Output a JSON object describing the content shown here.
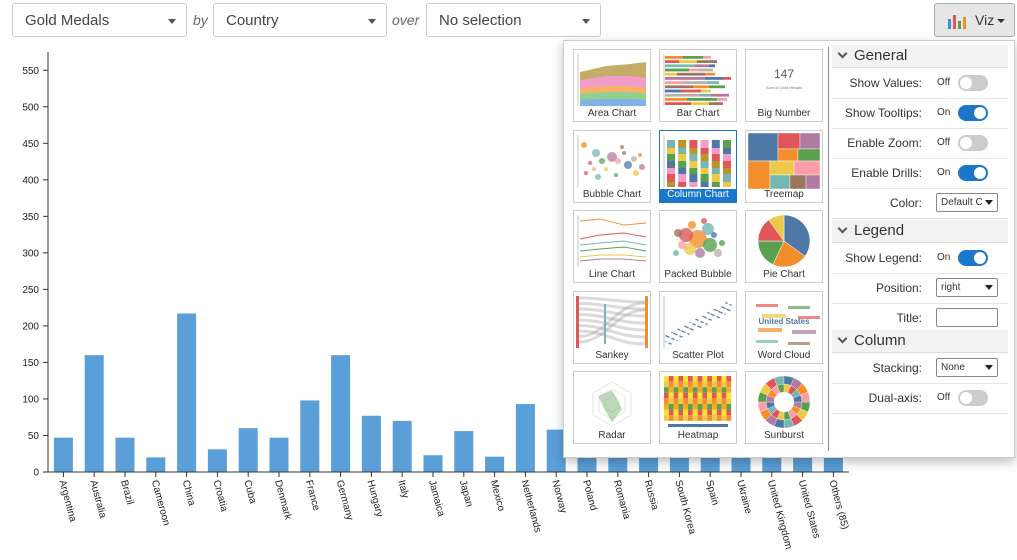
{
  "toolbar": {
    "measure": "Gold Medals",
    "by_label": "by",
    "dimension": "Country",
    "over_label": "over",
    "over_value": "No selection",
    "viz_label": "Viz"
  },
  "chart_data": {
    "type": "bar",
    "categories": [
      "Argentina",
      "Australia",
      "Brazil",
      "Cameroon",
      "China",
      "Croatia",
      "Cuba",
      "Denmark",
      "France",
      "Germany",
      "Hungary",
      "Italy",
      "Jamaica",
      "Japan",
      "Mexico",
      "Netherlands",
      "Norway",
      "Poland",
      "Romania",
      "Russia",
      "South Korea",
      "Spain",
      "Ukraine",
      "United Kingdom",
      "United States",
      "Others (85)"
    ],
    "values": [
      47,
      160,
      47,
      20,
      217,
      31,
      60,
      47,
      98,
      160,
      77,
      70,
      23,
      56,
      21,
      93,
      58,
      55,
      55,
      55,
      55,
      55,
      55,
      55,
      55,
      55
    ],
    "yticks": [
      "0",
      "50",
      "100",
      "150",
      "200",
      "250",
      "300",
      "350",
      "400",
      "450",
      "500",
      "550"
    ],
    "ylim": [
      0,
      575
    ],
    "color": "#5a9fd8"
  },
  "gallery": [
    {
      "label": "Area Chart",
      "icon": "area-chart-icon"
    },
    {
      "label": "Bar Chart",
      "icon": "bar-chart-icon"
    },
    {
      "label": "Big Number",
      "icon": "big-number-icon",
      "number": "147",
      "caption": "Sum of Gold Medals"
    },
    {
      "label": "Bubble Chart",
      "icon": "bubble-chart-icon"
    },
    {
      "label": "Column Chart",
      "icon": "column-chart-icon",
      "selected": true
    },
    {
      "label": "Treemap",
      "icon": "treemap-icon"
    },
    {
      "label": "Line Chart",
      "icon": "line-chart-icon"
    },
    {
      "label": "Packed Bubble",
      "icon": "packed-bubble-icon"
    },
    {
      "label": "Pie Chart",
      "icon": "pie-chart-icon"
    },
    {
      "label": "Sankey",
      "icon": "sankey-icon"
    },
    {
      "label": "Scatter Plot",
      "icon": "scatter-plot-icon"
    },
    {
      "label": "Word Cloud",
      "icon": "word-cloud-icon",
      "words": [
        "United States"
      ]
    },
    {
      "label": "Radar",
      "icon": "radar-icon"
    },
    {
      "label": "Heatmap",
      "icon": "heatmap-icon"
    },
    {
      "label": "Sunburst",
      "icon": "sunburst-icon"
    }
  ],
  "props": {
    "general": {
      "title": "General",
      "show_values": {
        "label": "Show Values:",
        "state": "Off"
      },
      "show_tooltips": {
        "label": "Show Tooltips:",
        "state": "On"
      },
      "enable_zoom": {
        "label": "Enable Zoom:",
        "state": "Off"
      },
      "enable_drills": {
        "label": "Enable Drills:",
        "state": "On"
      },
      "color": {
        "label": "Color:",
        "value": "Default C"
      }
    },
    "legend": {
      "title": "Legend",
      "show_legend": {
        "label": "Show Legend:",
        "state": "On"
      },
      "position": {
        "label": "Position:",
        "value": "right"
      },
      "title_field": {
        "label": "Title:",
        "value": ""
      }
    },
    "column": {
      "title": "Column",
      "stacking": {
        "label": "Stacking:",
        "value": "None"
      },
      "dual_axis": {
        "label": "Dual-axis:",
        "state": "Off"
      }
    }
  },
  "colors": {
    "accent": "#1a77c9",
    "bar": "#5a9fd8"
  }
}
